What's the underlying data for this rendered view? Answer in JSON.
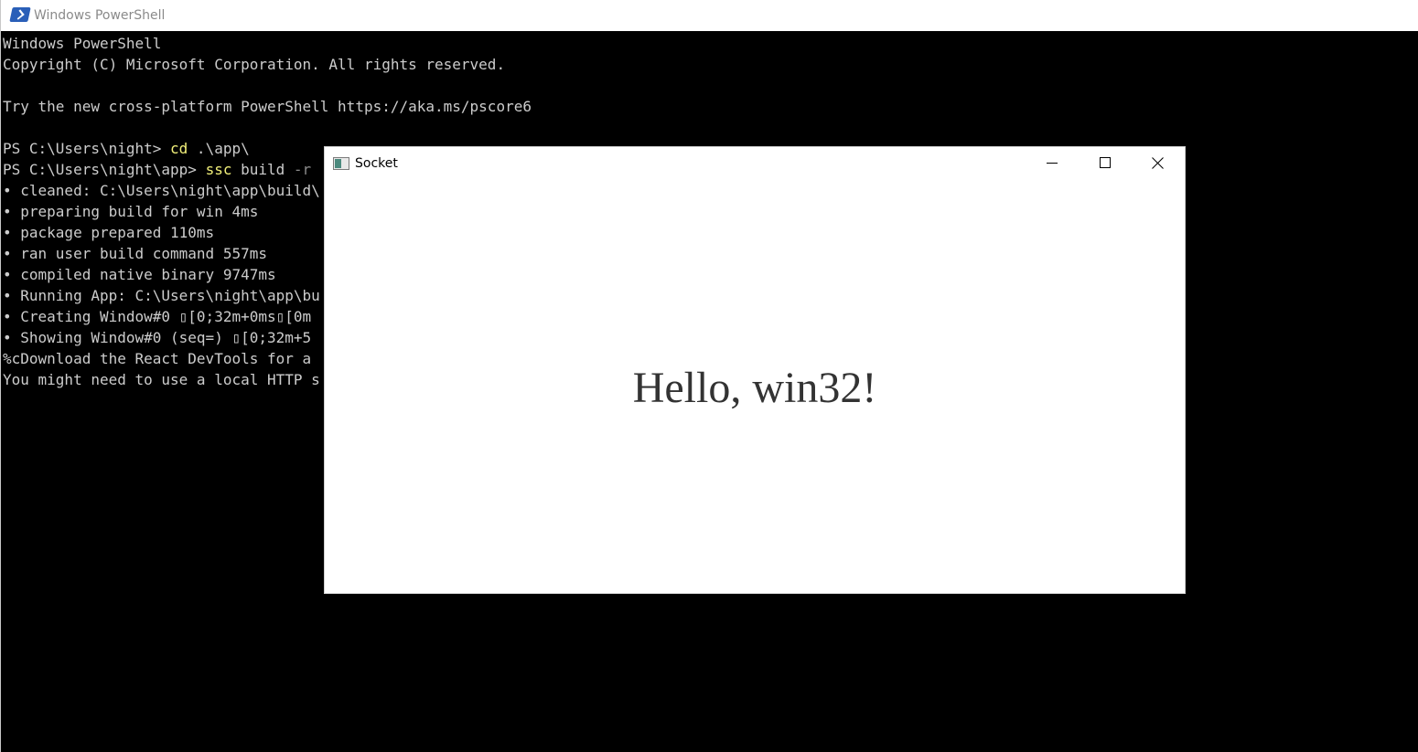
{
  "powershell": {
    "title": "Windows PowerShell",
    "lines": [
      [
        {
          "t": "Windows PowerShell",
          "c": ""
        }
      ],
      [
        {
          "t": "Copyright (C) Microsoft Corporation. All rights reserved.",
          "c": ""
        }
      ],
      [
        {
          "t": "",
          "c": ""
        }
      ],
      [
        {
          "t": "Try the new cross-platform PowerShell https://aka.ms/pscore6",
          "c": ""
        }
      ],
      [
        {
          "t": "",
          "c": ""
        }
      ],
      [
        {
          "t": "PS C:\\Users\\night> ",
          "c": ""
        },
        {
          "t": "cd",
          "c": "cmd"
        },
        {
          "t": " .\\app\\",
          "c": ""
        }
      ],
      [
        {
          "t": "PS C:\\Users\\night\\app> ",
          "c": ""
        },
        {
          "t": "ssc",
          "c": "cmd"
        },
        {
          "t": " build ",
          "c": ""
        },
        {
          "t": "-r",
          "c": "arg"
        }
      ],
      [
        {
          "t": "• cleaned: C:\\Users\\night\\app\\build\\",
          "c": ""
        }
      ],
      [
        {
          "t": "• preparing build for win 4ms",
          "c": ""
        }
      ],
      [
        {
          "t": "• package prepared 110ms",
          "c": ""
        }
      ],
      [
        {
          "t": "• ran user build command 557ms",
          "c": ""
        }
      ],
      [
        {
          "t": "• compiled native binary 9747ms",
          "c": ""
        }
      ],
      [
        {
          "t": "• Running App: C:\\Users\\night\\app\\bu",
          "c": ""
        }
      ],
      [
        {
          "t": "• Creating Window#0 ▯[0;32m+0ms▯[0m",
          "c": ""
        }
      ],
      [
        {
          "t": "• Showing Window#0 (seq=) ▯[0;32m+5",
          "c": ""
        }
      ],
      [
        {
          "t": "%cDownload the React DevTools for a",
          "c": ""
        }
      ],
      [
        {
          "t": "You might need to use a local HTTP s",
          "c": ""
        }
      ]
    ]
  },
  "socket": {
    "title": "Socket",
    "content_text": "Hello, win32!",
    "buttons": {
      "minimize": "minimize",
      "maximize": "maximize",
      "close": "close"
    }
  }
}
